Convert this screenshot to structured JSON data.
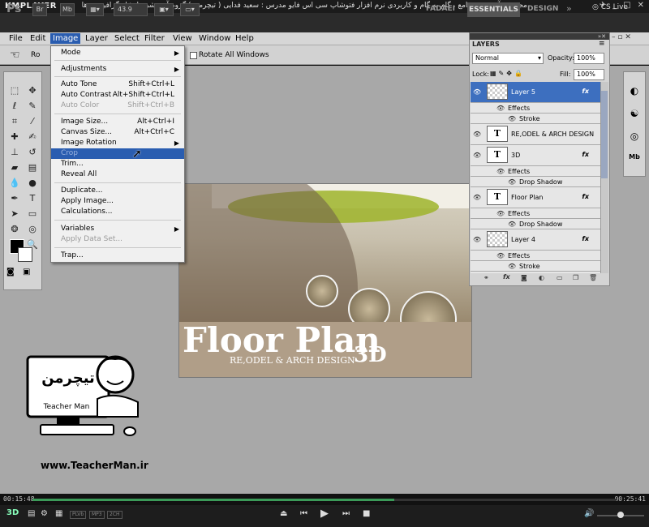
{
  "km": {
    "logo": "KMPLAYER",
    "caption": "مجموعه آموزشی جامع ، گام به گام و کاربردی نرم افزار فتوشاپ سی اس فایو مدرس : سعید فدایی ( تیچرمن ) گروه آموزشی پادشاه گرافیست ها",
    "time_current": "00:15:48",
    "time_total": "00:25:41",
    "progress": 0.62,
    "tags": [
      "PLVb",
      "MP3",
      "2CH"
    ],
    "volume": 0.5
  },
  "ps": {
    "logo": "Ps",
    "br": "Br",
    "mb": "Mb",
    "zoom": "43.9",
    "workspaces": [
      "FADAEI",
      "ESSENTIALS",
      "DESIGN"
    ],
    "more": "»",
    "cslive": "CS Live"
  },
  "menubar": [
    "File",
    "Edit",
    "Image",
    "Layer",
    "Select",
    "Filter",
    "View",
    "Window",
    "Help"
  ],
  "options": {
    "rotate_label": "Rotate All Windows",
    "ro": "Ro"
  },
  "image_menu": {
    "mode": "Mode",
    "adjustments": "Adjustments",
    "auto_tone": "Auto Tone",
    "auto_tone_sc": "Shift+Ctrl+L",
    "auto_contrast": "Auto Contrast",
    "auto_contrast_sc": "Alt+Shift+Ctrl+L",
    "auto_color": "Auto Color",
    "auto_color_sc": "Shift+Ctrl+B",
    "image_size": "Image Size...",
    "image_size_sc": "Alt+Ctrl+I",
    "canvas_size": "Canvas Size...",
    "canvas_size_sc": "Alt+Ctrl+C",
    "image_rotation": "Image Rotation",
    "crop": "Crop",
    "trim": "Trim...",
    "reveal_all": "Reveal All",
    "duplicate": "Duplicate...",
    "apply_image": "Apply Image...",
    "calculations": "Calculations...",
    "variables": "Variables",
    "apply_data_set": "Apply Data Set...",
    "trap": "Trap..."
  },
  "canvas": {
    "title": "Floor Plan",
    "three_d": "3D",
    "subtitle": "RE,ODEL & ARCH DESIGN"
  },
  "layers": {
    "tab": "LAYERS",
    "blend": "Normal",
    "opacity_label": "Opacity:",
    "opacity": "100%",
    "lock_label": "Lock:",
    "fill_label": "Fill:",
    "fill": "100%",
    "rows": [
      {
        "name": "Layer 5",
        "fx": "fx"
      },
      {
        "name": "Effects"
      },
      {
        "name": "Stroke"
      },
      {
        "name": "RE,ODEL & ARCH DESIGN"
      },
      {
        "name": "3D",
        "fx": "fx"
      },
      {
        "name": "Effects"
      },
      {
        "name": "Drop Shadow"
      },
      {
        "name": "Floor Plan",
        "fx": "fx"
      },
      {
        "name": "Effects"
      },
      {
        "name": "Drop Shadow"
      },
      {
        "name": "Layer 4",
        "fx": "fx"
      },
      {
        "name": "Effects"
      },
      {
        "name": "Stroke"
      }
    ],
    "text_thumb": "T"
  },
  "teacherman": {
    "url": "www.TeacherMan.ir",
    "name": "Teacher Man"
  },
  "colors": {
    "accent": "#2a5db0",
    "seek": "#3b9a58"
  }
}
